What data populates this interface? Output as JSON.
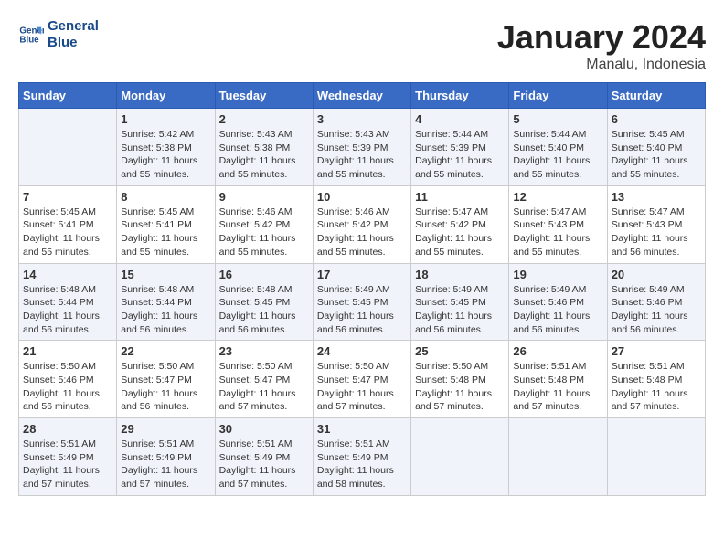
{
  "logo": {
    "line1": "General",
    "line2": "Blue"
  },
  "title": "January 2024",
  "location": "Manalu, Indonesia",
  "days_of_week": [
    "Sunday",
    "Monday",
    "Tuesday",
    "Wednesday",
    "Thursday",
    "Friday",
    "Saturday"
  ],
  "weeks": [
    [
      {
        "day": "",
        "info": ""
      },
      {
        "day": "1",
        "info": "Sunrise: 5:42 AM\nSunset: 5:38 PM\nDaylight: 11 hours\nand 55 minutes."
      },
      {
        "day": "2",
        "info": "Sunrise: 5:43 AM\nSunset: 5:38 PM\nDaylight: 11 hours\nand 55 minutes."
      },
      {
        "day": "3",
        "info": "Sunrise: 5:43 AM\nSunset: 5:39 PM\nDaylight: 11 hours\nand 55 minutes."
      },
      {
        "day": "4",
        "info": "Sunrise: 5:44 AM\nSunset: 5:39 PM\nDaylight: 11 hours\nand 55 minutes."
      },
      {
        "day": "5",
        "info": "Sunrise: 5:44 AM\nSunset: 5:40 PM\nDaylight: 11 hours\nand 55 minutes."
      },
      {
        "day": "6",
        "info": "Sunrise: 5:45 AM\nSunset: 5:40 PM\nDaylight: 11 hours\nand 55 minutes."
      }
    ],
    [
      {
        "day": "7",
        "info": "Sunrise: 5:45 AM\nSunset: 5:41 PM\nDaylight: 11 hours\nand 55 minutes."
      },
      {
        "day": "8",
        "info": "Sunrise: 5:45 AM\nSunset: 5:41 PM\nDaylight: 11 hours\nand 55 minutes."
      },
      {
        "day": "9",
        "info": "Sunrise: 5:46 AM\nSunset: 5:42 PM\nDaylight: 11 hours\nand 55 minutes."
      },
      {
        "day": "10",
        "info": "Sunrise: 5:46 AM\nSunset: 5:42 PM\nDaylight: 11 hours\nand 55 minutes."
      },
      {
        "day": "11",
        "info": "Sunrise: 5:47 AM\nSunset: 5:42 PM\nDaylight: 11 hours\nand 55 minutes."
      },
      {
        "day": "12",
        "info": "Sunrise: 5:47 AM\nSunset: 5:43 PM\nDaylight: 11 hours\nand 55 minutes."
      },
      {
        "day": "13",
        "info": "Sunrise: 5:47 AM\nSunset: 5:43 PM\nDaylight: 11 hours\nand 56 minutes."
      }
    ],
    [
      {
        "day": "14",
        "info": "Sunrise: 5:48 AM\nSunset: 5:44 PM\nDaylight: 11 hours\nand 56 minutes."
      },
      {
        "day": "15",
        "info": "Sunrise: 5:48 AM\nSunset: 5:44 PM\nDaylight: 11 hours\nand 56 minutes."
      },
      {
        "day": "16",
        "info": "Sunrise: 5:48 AM\nSunset: 5:45 PM\nDaylight: 11 hours\nand 56 minutes."
      },
      {
        "day": "17",
        "info": "Sunrise: 5:49 AM\nSunset: 5:45 PM\nDaylight: 11 hours\nand 56 minutes."
      },
      {
        "day": "18",
        "info": "Sunrise: 5:49 AM\nSunset: 5:45 PM\nDaylight: 11 hours\nand 56 minutes."
      },
      {
        "day": "19",
        "info": "Sunrise: 5:49 AM\nSunset: 5:46 PM\nDaylight: 11 hours\nand 56 minutes."
      },
      {
        "day": "20",
        "info": "Sunrise: 5:49 AM\nSunset: 5:46 PM\nDaylight: 11 hours\nand 56 minutes."
      }
    ],
    [
      {
        "day": "21",
        "info": "Sunrise: 5:50 AM\nSunset: 5:46 PM\nDaylight: 11 hours\nand 56 minutes."
      },
      {
        "day": "22",
        "info": "Sunrise: 5:50 AM\nSunset: 5:47 PM\nDaylight: 11 hours\nand 56 minutes."
      },
      {
        "day": "23",
        "info": "Sunrise: 5:50 AM\nSunset: 5:47 PM\nDaylight: 11 hours\nand 57 minutes."
      },
      {
        "day": "24",
        "info": "Sunrise: 5:50 AM\nSunset: 5:47 PM\nDaylight: 11 hours\nand 57 minutes."
      },
      {
        "day": "25",
        "info": "Sunrise: 5:50 AM\nSunset: 5:48 PM\nDaylight: 11 hours\nand 57 minutes."
      },
      {
        "day": "26",
        "info": "Sunrise: 5:51 AM\nSunset: 5:48 PM\nDaylight: 11 hours\nand 57 minutes."
      },
      {
        "day": "27",
        "info": "Sunrise: 5:51 AM\nSunset: 5:48 PM\nDaylight: 11 hours\nand 57 minutes."
      }
    ],
    [
      {
        "day": "28",
        "info": "Sunrise: 5:51 AM\nSunset: 5:49 PM\nDaylight: 11 hours\nand 57 minutes."
      },
      {
        "day": "29",
        "info": "Sunrise: 5:51 AM\nSunset: 5:49 PM\nDaylight: 11 hours\nand 57 minutes."
      },
      {
        "day": "30",
        "info": "Sunrise: 5:51 AM\nSunset: 5:49 PM\nDaylight: 11 hours\nand 57 minutes."
      },
      {
        "day": "31",
        "info": "Sunrise: 5:51 AM\nSunset: 5:49 PM\nDaylight: 11 hours\nand 58 minutes."
      },
      {
        "day": "",
        "info": ""
      },
      {
        "day": "",
        "info": ""
      },
      {
        "day": "",
        "info": ""
      }
    ]
  ]
}
